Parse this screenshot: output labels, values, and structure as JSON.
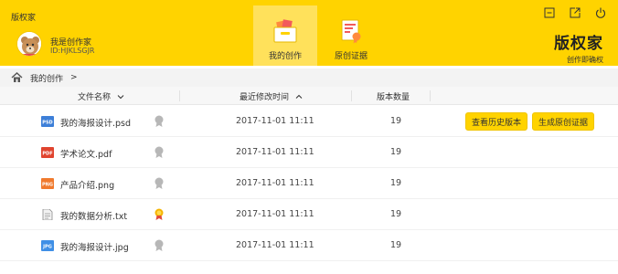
{
  "window": {
    "title": "版权家",
    "controls": [
      "minimize-icon",
      "popout-icon",
      "power-icon"
    ]
  },
  "user": {
    "name": "我是创作家",
    "id": "ID:HJKLSGJR",
    "avatar": "bear-avatar"
  },
  "nav": {
    "tabs": [
      {
        "label": "我的创作",
        "icon": "folder-icon",
        "active": true
      },
      {
        "label": "原创证据",
        "icon": "certificate-icon",
        "active": false
      }
    ]
  },
  "brand": {
    "name": "版权家",
    "slogan": "创作即确权"
  },
  "breadcrumb": {
    "icon": "home-icon",
    "current": "我的创作",
    "separator": ">"
  },
  "table": {
    "columns": [
      {
        "label": "文件名称",
        "sort": "desc"
      },
      {
        "label": "最近修改时间",
        "sort": "asc"
      },
      {
        "label": "版本数量"
      }
    ],
    "rows": [
      {
        "name": "我的海报设计.psd",
        "type": "psd",
        "type_label": "PSD",
        "badge": "gray",
        "modified": "2017-11-01  11:11",
        "versions": "19",
        "actions": [
          "查看历史版本",
          "生成原创证据"
        ]
      },
      {
        "name": "学术论文.pdf",
        "type": "pdf",
        "type_label": "PDF",
        "badge": "gray",
        "modified": "2017-11-01  11:11",
        "versions": "19",
        "actions": []
      },
      {
        "name": "产品介绍.png",
        "type": "png",
        "type_label": "PNG",
        "badge": "gray",
        "modified": "2017-11-01  11:11",
        "versions": "19",
        "actions": []
      },
      {
        "name": "我的数据分析.txt",
        "type": "txt",
        "type_label": "",
        "badge": "gold",
        "modified": "2017-11-01  11:11",
        "versions": "19",
        "actions": []
      },
      {
        "name": "我的海报设计.jpg",
        "type": "jpg",
        "type_label": "JPG",
        "badge": "gray",
        "modified": "2017-11-01  11:11",
        "versions": "19",
        "actions": []
      }
    ]
  },
  "colors": {
    "accent": "#ffd300",
    "active_tab": "#ffe15b",
    "psd": "#3d7fd8",
    "pdf": "#e0442f",
    "png": "#f07a2e",
    "jpg": "#3f8fe6",
    "gold_badge": "#f5b400",
    "gray_badge": "#b7b7b7"
  }
}
